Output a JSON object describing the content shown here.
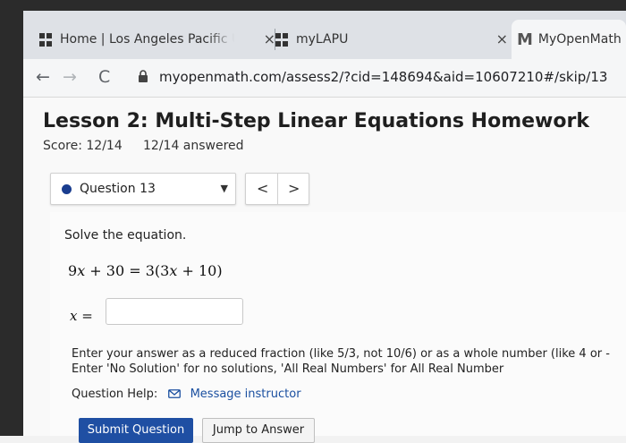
{
  "browser": {
    "tabs": [
      {
        "title": "Home | Los Angeles Pacific Un",
        "close": "×",
        "icon": "lapu-favicon-icon"
      },
      {
        "title": "myLAPU",
        "close": "×",
        "icon": "lapu-favicon-icon"
      },
      {
        "title": "MyOpenMath",
        "icon": "gmail-m-icon",
        "glyph": "M"
      }
    ],
    "nav": {
      "back": "←",
      "forward": "→",
      "reload": "C"
    },
    "url": "myopenmath.com/assess2/?cid=148694&aid=10607210#/skip/13"
  },
  "assessment": {
    "title": "Lesson 2: Multi-Step Linear Equations Homework",
    "score": "Score: 12/14",
    "answered": "12/14 answered",
    "question_select": {
      "label": "Question 13",
      "caret": "▼"
    },
    "prev": "<",
    "next": ">"
  },
  "question": {
    "instruction": "Solve the equation.",
    "equation": {
      "lhs_coef": "9",
      "var": "x",
      "lhs_rest": " + 30 = 3(3",
      "var2": "x",
      "rhs_rest": " + 10)"
    },
    "answer_label": {
      "var": "x",
      "eq": " ="
    },
    "answer_value": "",
    "hint_line1": "Enter your answer as a reduced fraction (like 5/3, not 10/6) or as a whole number (like 4 or -",
    "hint_line2": "Enter 'No Solution' for no solutions, 'All Real Numbers' for All Real Number",
    "help_label": "Question Help:",
    "message_link": "Message instructor",
    "submit": "Submit Question",
    "jump": "Jump to Answer"
  },
  "colors": {
    "accent": "#1f4fa3",
    "dot": "#1a3d8f",
    "link": "#1a4fa0"
  }
}
